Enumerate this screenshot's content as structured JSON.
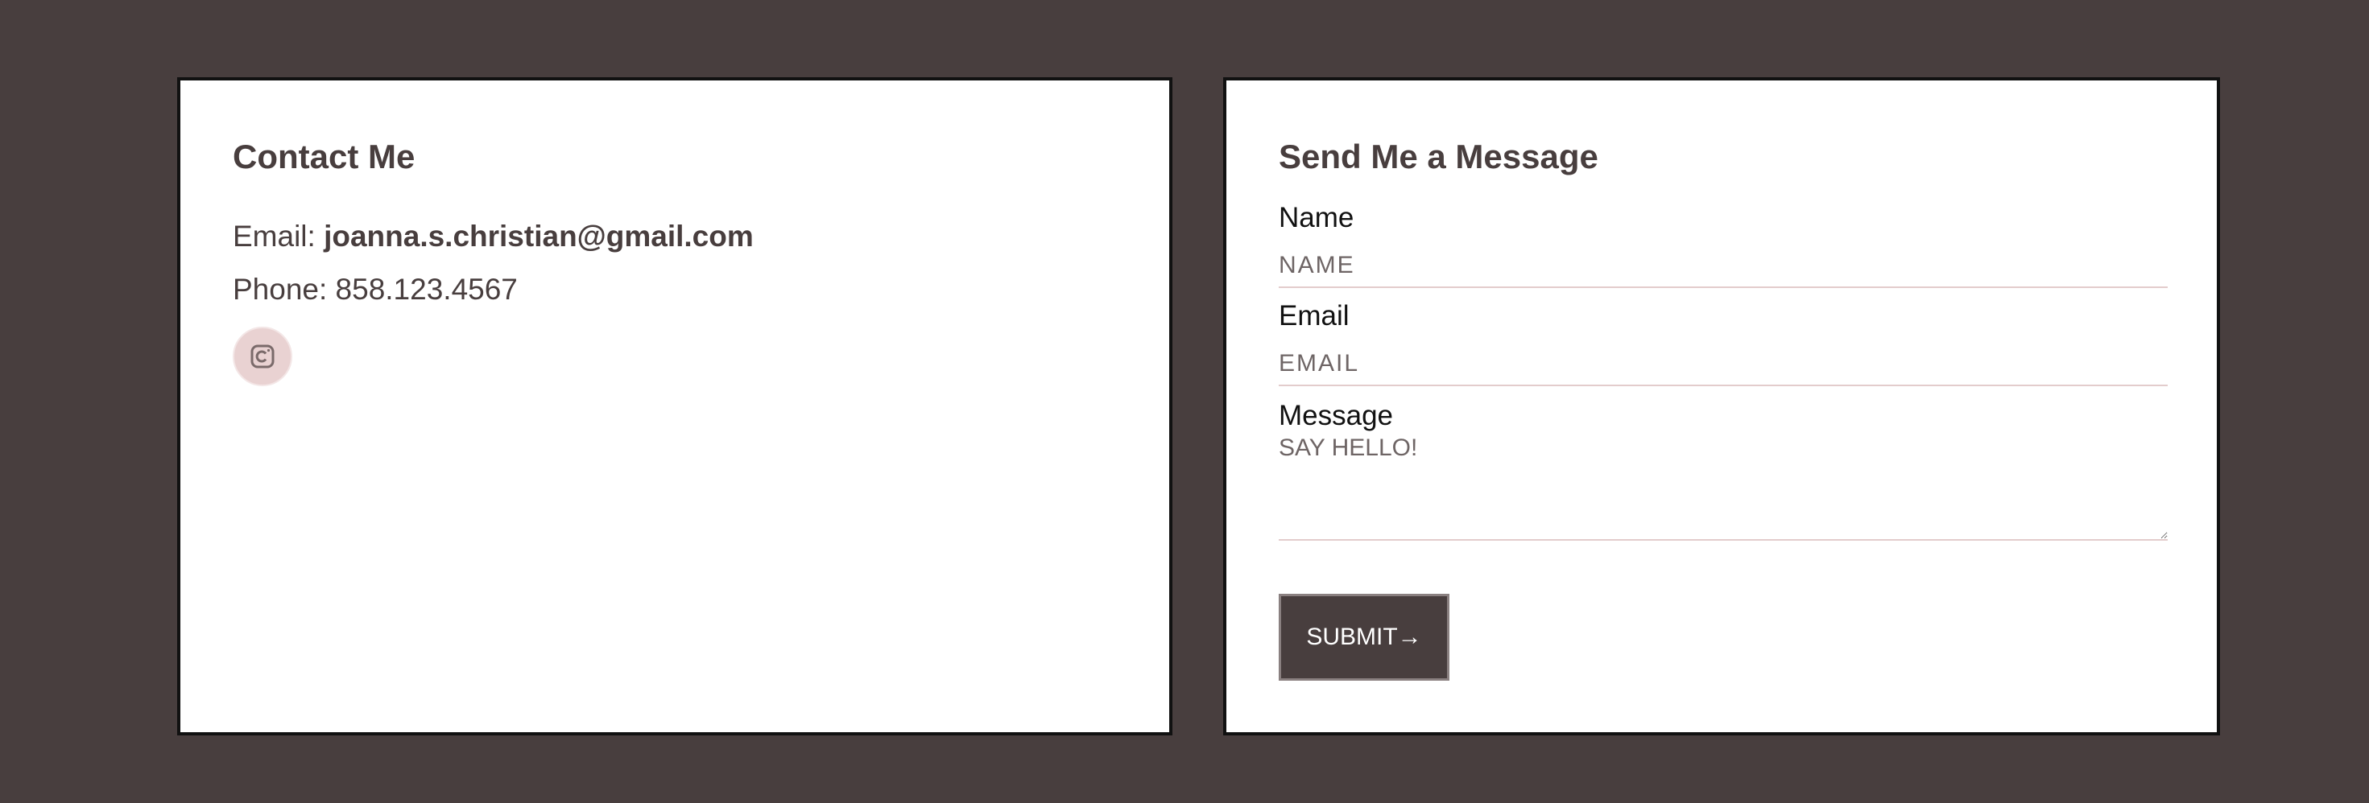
{
  "contact": {
    "title": "Contact Me",
    "email_prefix": "Email: ",
    "email_value": "joanna.s.christian@gmail.com",
    "phone_text": "Phone: 858.123.4567",
    "social_icon": "instagram-icon"
  },
  "form": {
    "title": "Send Me a Message",
    "name_label": "Name",
    "name_placeholder": "NAME",
    "email_label": "Email",
    "email_placeholder": "EMAIL",
    "message_label": "Message",
    "message_placeholder": "SAY HELLO!",
    "submit_label": "SUBMIT→"
  },
  "colors": {
    "page_background": "#483e3e",
    "card_background": "#ffffff",
    "text": "#483e3e",
    "accent_pink": "#e9d2d2",
    "input_border": "#e3cccc"
  }
}
